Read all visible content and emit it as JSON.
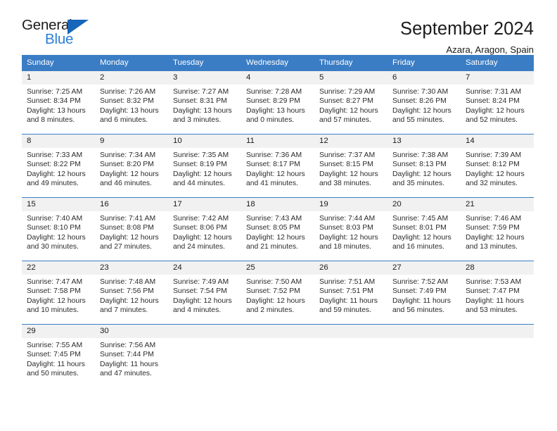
{
  "logo": {
    "word_top": "General",
    "word_bottom": "Blue",
    "triangle_icon": "blue-triangle-icon",
    "accent_color": "#2a7fd4",
    "triangle_color": "#1666ba"
  },
  "header": {
    "title": "September 2024",
    "subtitle": "Azara, Aragon, Spain"
  },
  "theme": {
    "header_background": "#3b7dc4",
    "header_text": "#ffffff",
    "daynum_background": "#f1f1f1",
    "body_text": "#2b2b2b"
  },
  "calendar": {
    "weekday_headers": [
      "Sunday",
      "Monday",
      "Tuesday",
      "Wednesday",
      "Thursday",
      "Friday",
      "Saturday"
    ],
    "labels": {
      "sunrise": "Sunrise:",
      "sunset": "Sunset:",
      "daylight": "Daylight:"
    },
    "weeks": [
      [
        {
          "day": "1",
          "sunrise": "Sunrise: 7:25 AM",
          "sunset": "Sunset: 8:34 PM",
          "daylight_line1": "Daylight: 13 hours",
          "daylight_line2": "and 8 minutes."
        },
        {
          "day": "2",
          "sunrise": "Sunrise: 7:26 AM",
          "sunset": "Sunset: 8:32 PM",
          "daylight_line1": "Daylight: 13 hours",
          "daylight_line2": "and 6 minutes."
        },
        {
          "day": "3",
          "sunrise": "Sunrise: 7:27 AM",
          "sunset": "Sunset: 8:31 PM",
          "daylight_line1": "Daylight: 13 hours",
          "daylight_line2": "and 3 minutes."
        },
        {
          "day": "4",
          "sunrise": "Sunrise: 7:28 AM",
          "sunset": "Sunset: 8:29 PM",
          "daylight_line1": "Daylight: 13 hours",
          "daylight_line2": "and 0 minutes."
        },
        {
          "day": "5",
          "sunrise": "Sunrise: 7:29 AM",
          "sunset": "Sunset: 8:27 PM",
          "daylight_line1": "Daylight: 12 hours",
          "daylight_line2": "and 57 minutes."
        },
        {
          "day": "6",
          "sunrise": "Sunrise: 7:30 AM",
          "sunset": "Sunset: 8:26 PM",
          "daylight_line1": "Daylight: 12 hours",
          "daylight_line2": "and 55 minutes."
        },
        {
          "day": "7",
          "sunrise": "Sunrise: 7:31 AM",
          "sunset": "Sunset: 8:24 PM",
          "daylight_line1": "Daylight: 12 hours",
          "daylight_line2": "and 52 minutes."
        }
      ],
      [
        {
          "day": "8",
          "sunrise": "Sunrise: 7:33 AM",
          "sunset": "Sunset: 8:22 PM",
          "daylight_line1": "Daylight: 12 hours",
          "daylight_line2": "and 49 minutes."
        },
        {
          "day": "9",
          "sunrise": "Sunrise: 7:34 AM",
          "sunset": "Sunset: 8:20 PM",
          "daylight_line1": "Daylight: 12 hours",
          "daylight_line2": "and 46 minutes."
        },
        {
          "day": "10",
          "sunrise": "Sunrise: 7:35 AM",
          "sunset": "Sunset: 8:19 PM",
          "daylight_line1": "Daylight: 12 hours",
          "daylight_line2": "and 44 minutes."
        },
        {
          "day": "11",
          "sunrise": "Sunrise: 7:36 AM",
          "sunset": "Sunset: 8:17 PM",
          "daylight_line1": "Daylight: 12 hours",
          "daylight_line2": "and 41 minutes."
        },
        {
          "day": "12",
          "sunrise": "Sunrise: 7:37 AM",
          "sunset": "Sunset: 8:15 PM",
          "daylight_line1": "Daylight: 12 hours",
          "daylight_line2": "and 38 minutes."
        },
        {
          "day": "13",
          "sunrise": "Sunrise: 7:38 AM",
          "sunset": "Sunset: 8:13 PM",
          "daylight_line1": "Daylight: 12 hours",
          "daylight_line2": "and 35 minutes."
        },
        {
          "day": "14",
          "sunrise": "Sunrise: 7:39 AM",
          "sunset": "Sunset: 8:12 PM",
          "daylight_line1": "Daylight: 12 hours",
          "daylight_line2": "and 32 minutes."
        }
      ],
      [
        {
          "day": "15",
          "sunrise": "Sunrise: 7:40 AM",
          "sunset": "Sunset: 8:10 PM",
          "daylight_line1": "Daylight: 12 hours",
          "daylight_line2": "and 30 minutes."
        },
        {
          "day": "16",
          "sunrise": "Sunrise: 7:41 AM",
          "sunset": "Sunset: 8:08 PM",
          "daylight_line1": "Daylight: 12 hours",
          "daylight_line2": "and 27 minutes."
        },
        {
          "day": "17",
          "sunrise": "Sunrise: 7:42 AM",
          "sunset": "Sunset: 8:06 PM",
          "daylight_line1": "Daylight: 12 hours",
          "daylight_line2": "and 24 minutes."
        },
        {
          "day": "18",
          "sunrise": "Sunrise: 7:43 AM",
          "sunset": "Sunset: 8:05 PM",
          "daylight_line1": "Daylight: 12 hours",
          "daylight_line2": "and 21 minutes."
        },
        {
          "day": "19",
          "sunrise": "Sunrise: 7:44 AM",
          "sunset": "Sunset: 8:03 PM",
          "daylight_line1": "Daylight: 12 hours",
          "daylight_line2": "and 18 minutes."
        },
        {
          "day": "20",
          "sunrise": "Sunrise: 7:45 AM",
          "sunset": "Sunset: 8:01 PM",
          "daylight_line1": "Daylight: 12 hours",
          "daylight_line2": "and 16 minutes."
        },
        {
          "day": "21",
          "sunrise": "Sunrise: 7:46 AM",
          "sunset": "Sunset: 7:59 PM",
          "daylight_line1": "Daylight: 12 hours",
          "daylight_line2": "and 13 minutes."
        }
      ],
      [
        {
          "day": "22",
          "sunrise": "Sunrise: 7:47 AM",
          "sunset": "Sunset: 7:58 PM",
          "daylight_line1": "Daylight: 12 hours",
          "daylight_line2": "and 10 minutes."
        },
        {
          "day": "23",
          "sunrise": "Sunrise: 7:48 AM",
          "sunset": "Sunset: 7:56 PM",
          "daylight_line1": "Daylight: 12 hours",
          "daylight_line2": "and 7 minutes."
        },
        {
          "day": "24",
          "sunrise": "Sunrise: 7:49 AM",
          "sunset": "Sunset: 7:54 PM",
          "daylight_line1": "Daylight: 12 hours",
          "daylight_line2": "and 4 minutes."
        },
        {
          "day": "25",
          "sunrise": "Sunrise: 7:50 AM",
          "sunset": "Sunset: 7:52 PM",
          "daylight_line1": "Daylight: 12 hours",
          "daylight_line2": "and 2 minutes."
        },
        {
          "day": "26",
          "sunrise": "Sunrise: 7:51 AM",
          "sunset": "Sunset: 7:51 PM",
          "daylight_line1": "Daylight: 11 hours",
          "daylight_line2": "and 59 minutes."
        },
        {
          "day": "27",
          "sunrise": "Sunrise: 7:52 AM",
          "sunset": "Sunset: 7:49 PM",
          "daylight_line1": "Daylight: 11 hours",
          "daylight_line2": "and 56 minutes."
        },
        {
          "day": "28",
          "sunrise": "Sunrise: 7:53 AM",
          "sunset": "Sunset: 7:47 PM",
          "daylight_line1": "Daylight: 11 hours",
          "daylight_line2": "and 53 minutes."
        }
      ],
      [
        {
          "day": "29",
          "sunrise": "Sunrise: 7:55 AM",
          "sunset": "Sunset: 7:45 PM",
          "daylight_line1": "Daylight: 11 hours",
          "daylight_line2": "and 50 minutes."
        },
        {
          "day": "30",
          "sunrise": "Sunrise: 7:56 AM",
          "sunset": "Sunset: 7:44 PM",
          "daylight_line1": "Daylight: 11 hours",
          "daylight_line2": "and 47 minutes."
        },
        {
          "day": "",
          "sunrise": "",
          "sunset": "",
          "daylight_line1": "",
          "daylight_line2": ""
        },
        {
          "day": "",
          "sunrise": "",
          "sunset": "",
          "daylight_line1": "",
          "daylight_line2": ""
        },
        {
          "day": "",
          "sunrise": "",
          "sunset": "",
          "daylight_line1": "",
          "daylight_line2": ""
        },
        {
          "day": "",
          "sunrise": "",
          "sunset": "",
          "daylight_line1": "",
          "daylight_line2": ""
        },
        {
          "day": "",
          "sunrise": "",
          "sunset": "",
          "daylight_line1": "",
          "daylight_line2": ""
        }
      ]
    ]
  }
}
